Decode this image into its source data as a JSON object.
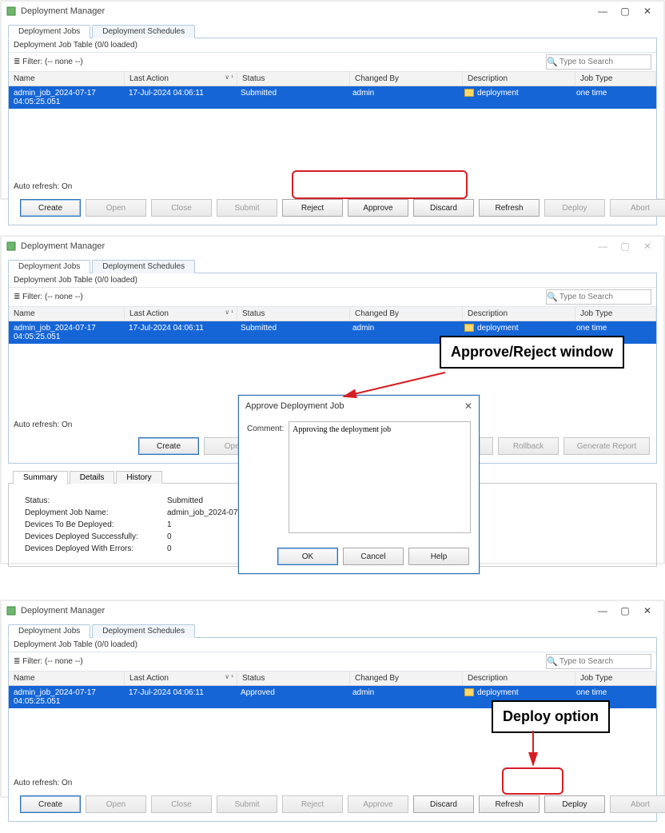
{
  "app_title": "Deployment Manager",
  "win_min": "—",
  "win_max": "▢",
  "win_close": "✕",
  "tabs": {
    "jobs": "Deployment Jobs",
    "schedules": "Deployment Schedules"
  },
  "panel_head": "Deployment Job Table (0/0 loaded)",
  "filter_label": "Filter: (-- none --)",
  "search_placeholder": "Type to Search",
  "cols": {
    "name": "Name",
    "last": "Last Action",
    "status": "Status",
    "changed": "Changed By",
    "desc": "Description",
    "type": "Job Type",
    "sort_ind": "∨ ¹"
  },
  "row": {
    "name": "admin_job_2024-07-17 04:05:25.051",
    "last": "17-Jul-2024 04:06:11",
    "status_submitted": "Submitted",
    "status_approved": "Approved",
    "changed": "admin",
    "desc": "deployment",
    "type": "one time"
  },
  "autorefresh": "Auto refresh: On",
  "btns": {
    "create": "Create",
    "open": "Open",
    "close": "Close",
    "submit": "Submit",
    "reject": "Reject",
    "approve": "Approve",
    "discard": "Discard",
    "refresh": "Refresh",
    "deploy": "Deploy",
    "abort": "Abort",
    "rollback": "Rollback",
    "report": "Generate Report"
  },
  "dialog": {
    "title": "Approve Deployment Job",
    "comment_label": "Comment:",
    "comment_value": "Approving the deployment job",
    "ok": "OK",
    "cancel": "Cancel",
    "help": "Help"
  },
  "summary": {
    "tabs": {
      "summary": "Summary",
      "details": "Details",
      "history": "History"
    },
    "k_status": "Status:",
    "v_status": "Submitted",
    "k_name": "Deployment Job Name:",
    "v_name": "admin_job_2024-07-17 04:05:25.051",
    "k_devices": "Devices To Be Deployed:",
    "v_devices": "1",
    "k_ok": "Devices Deployed Successfully:",
    "v_ok": "0",
    "k_err": "Devices Deployed With Errors:",
    "v_err": "0"
  },
  "annot": {
    "approve_reject": "Approve/Reject window",
    "deploy_option": "Deploy option"
  }
}
